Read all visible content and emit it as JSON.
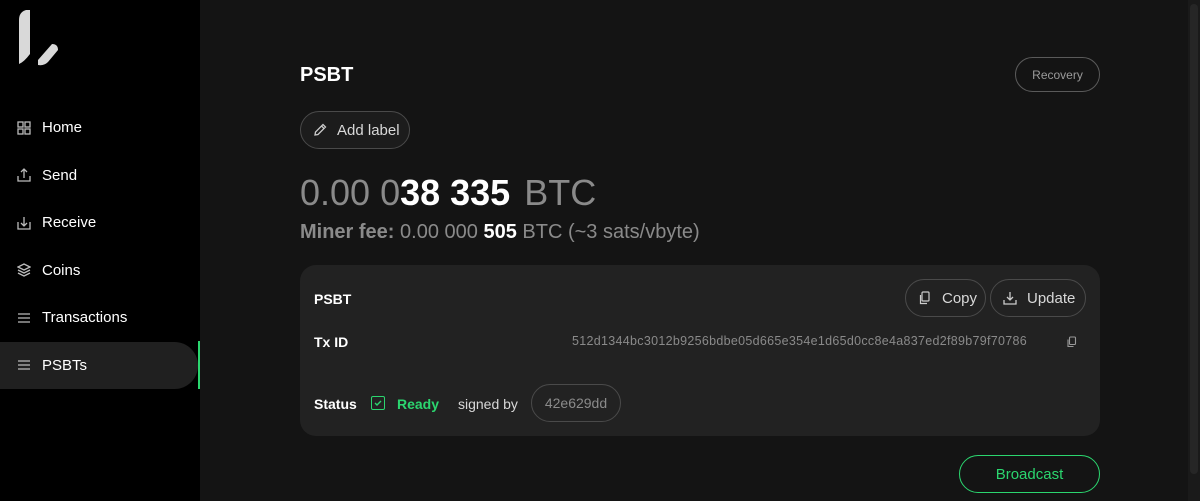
{
  "sidebar": {
    "items": [
      {
        "label": "Home",
        "icon": "home-grid-icon"
      },
      {
        "label": "Send",
        "icon": "send-icon"
      },
      {
        "label": "Receive",
        "icon": "receive-icon"
      },
      {
        "label": "Coins",
        "icon": "coins-stack-icon"
      },
      {
        "label": "Transactions",
        "icon": "list-icon"
      },
      {
        "label": "PSBTs",
        "icon": "list-icon",
        "active": true
      }
    ]
  },
  "header": {
    "title": "PSBT",
    "recovery_label": "Recovery",
    "add_label_label": "Add label"
  },
  "amount": {
    "dim_part": "0.00 0",
    "bright_part": "38 335",
    "unit": "BTC"
  },
  "fee": {
    "label": "Miner fee:",
    "dim_part": "0.00 000",
    "bright_part": "505",
    "unit_rate": "BTC (~3 sats/vbyte)"
  },
  "card": {
    "psbt_label": "PSBT",
    "copy_label": "Copy",
    "update_label": "Update",
    "txid_label": "Tx ID",
    "txid_value": "512d1344bc3012b9256bdbe05d665e354e1d65d0cc8e4a837ed2f89b79f70786",
    "status_label": "Status",
    "status_value": "Ready",
    "signed_by_label": "signed by",
    "signer": "42e629dd"
  },
  "actions": {
    "broadcast_label": "Broadcast"
  },
  "colors": {
    "accent": "#2bd66f",
    "background": "#141414",
    "sidebar": "#000000",
    "card": "#222222"
  }
}
